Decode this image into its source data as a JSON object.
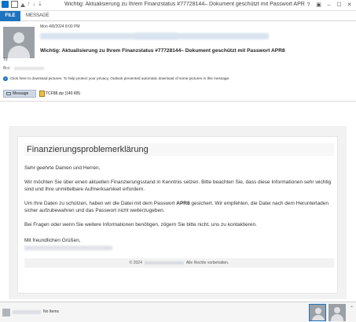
{
  "window": {
    "title": "Wichtig: Aktualisierung zu Ihrem Finanzstatus #77728144– Dokument geschützt mit Passwort APR8 - Mess...",
    "minimize": "–",
    "maximize": "☐",
    "close": "✕"
  },
  "ribbon": {
    "tabs": [
      "FILE",
      "MESSAGE"
    ]
  },
  "header": {
    "datetime": "Mon 4/8/2024 8:00 PM",
    "subject": "Wichtig: Aktualisierung zu Ihrem Finanzstatus #77728144– Dokument geschützt mit Passwort APR8",
    "to_label": "To:",
    "bcc_label": "Bcc:"
  },
  "infobar": {
    "icon": "info-icon",
    "text": "Click here to download pictures. To help protect your privacy, Outlook prevented automatic download of some pictures in this message."
  },
  "attachments": {
    "message_label": "Message",
    "file_name": "TCF88.zip (140 KB)"
  },
  "email": {
    "title": "Finanzierungsproblemerklärung",
    "greeting": "Sehr geehrte Damen und Herren,",
    "para1": "Wir möchten Sie über einen aktuellen Finanzierungsstand in Kenntnis setzen. Bitte beachten Sie, dass diese Informationen sehr wichtig sind und Ihre unmittelbare Aufmerksamkeit erfordern.",
    "para2_prefix": "Um Ihre Daten zu schützen, haben wir die Datei mit dem Passwort ",
    "para2_password": "APR8",
    "para2_suffix": " gesichert. Wir empfehlen, die Datei nach dem Herunterladen sicher aufzubewahren und das Passwort nicht weiterzugeben.",
    "para3": "Bei Fragen oder wenn Sie weitere Informationen benötigen, zögern Sie bitte nicht, uns zu kontaktieren.",
    "closing": "Mit freundlichen Grüßen,",
    "footer_prefix": "© 2024",
    "footer_suffix": "Alle Rechte vorbehalten."
  },
  "statusbar": {
    "text": "No Items"
  },
  "colors": {
    "accent": "#1e73be",
    "frame": "#f2f2f2"
  }
}
